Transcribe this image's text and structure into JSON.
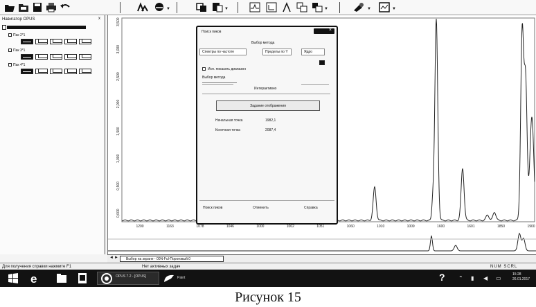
{
  "navigator": {
    "title": "Навигатор OPUS",
    "pin": "x",
    "files": [
      {
        "name": "Пак 2*1"
      },
      {
        "name": "Пак 3*1"
      },
      {
        "name": "Пак 4*1"
      }
    ]
  },
  "plot": {
    "y_tick_labels": [
      "3,500",
      "3,000",
      "2,500",
      "2,000",
      "1,500",
      "1,000",
      "0,500",
      "0,000"
    ],
    "x_tick_labels": [
      "1200",
      "1163",
      "1078",
      "1046",
      "1000",
      "1062",
      "1051",
      "1060",
      "1010",
      "1009",
      "1600",
      "1601",
      "1850",
      "1900"
    ],
    "colors": {
      "spectrum": "#222222",
      "background": "#ffffff"
    }
  },
  "dialog": {
    "title": "Поиск пиков",
    "close_glyph": "×",
    "method_header": "Выбор метода",
    "tab_labels": [
      "Спектры по частоте",
      "Пределы по Y",
      "Ядро"
    ],
    "show_label": "Исп. показать диапазон",
    "method_select_label": "Выбор метода",
    "section_header": "Интерактивно",
    "reset_button": "Задание отображения",
    "label_freq": "Начальная точка",
    "value_freq": "1982,1",
    "label_end": "Конечная точка",
    "value_end": "2087,4",
    "buttons": {
      "find": "Поиск пиков",
      "cancel": "Отменить",
      "help": "Справка"
    }
  },
  "tabbar": {
    "tab_label": "Выбор на экране - 00N-Ful-Пороговый.0",
    "arrow_left": "◄",
    "arrow_right": "►"
  },
  "statusbar": {
    "left": "Для получения справки нажмите F1",
    "middle": "Нет активных задач",
    "right": "NUM  SCRL"
  },
  "taskbar": {
    "app_label": "OPUS 7.2 - [OPUS]",
    "app2_label": "Paint",
    "clock_time": "15:28",
    "clock_date": "26.01.2017",
    "help_glyph": "?"
  },
  "caption": "Рисунок 15"
}
